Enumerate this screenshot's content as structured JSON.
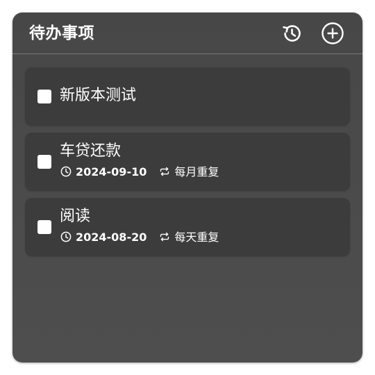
{
  "header": {
    "title": "待办事项",
    "history_icon": "history-icon",
    "add_icon": "add-circle-icon"
  },
  "tasks": [
    {
      "title": "新版本测试",
      "checked": false
    },
    {
      "title": "车贷还款",
      "date": "2024-09-10",
      "repeat": "每月重复",
      "checked": false
    },
    {
      "title": "阅读",
      "date": "2024-08-20",
      "repeat": "每天重复",
      "checked": false
    }
  ],
  "colors": {
    "widget_bg": "#4a4a4a",
    "card_bg": "#3c3c3c",
    "text": "#ffffff",
    "divider": "#7a7a7a"
  }
}
